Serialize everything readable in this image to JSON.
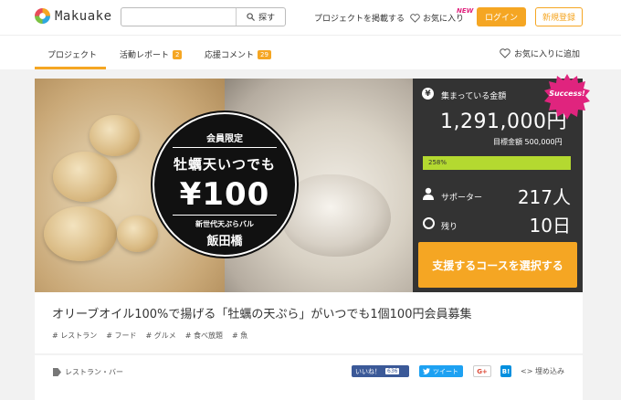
{
  "header": {
    "logo_text": "Makuake",
    "search_placeholder": "",
    "search_button": "探す",
    "post_project": "プロジェクトを掲載する",
    "favorites": "お気に入り",
    "new_badge": "NEW",
    "login": "ログイン",
    "signup": "新規登録"
  },
  "tabs": [
    {
      "label": "プロジェクト",
      "count": ""
    },
    {
      "label": "活動レポート",
      "count": "2"
    },
    {
      "label": "応援コメント",
      "count": "29"
    }
  ],
  "add_favorite": "お気に入りに追加",
  "hero": {
    "members_only": "会員限定",
    "headline": "牡蠣天いつでも",
    "price": "¥100",
    "subtitle": "新世代天ぷらバル",
    "place": "飯田橋"
  },
  "stats": {
    "raised_label": "集まっている金額",
    "raised_amount": "1,291,000円",
    "goal": "目標金額 500,000円",
    "progress_label": "258%",
    "progress_percent": 258,
    "supporters_label": "サポーター",
    "supporters_value": "217人",
    "remaining_label": "残り",
    "remaining_value": "10日",
    "success_badge": "Success!",
    "choose_button": "支援するコースを選択する"
  },
  "project": {
    "title": "オリーブオイル100%で揚げる「牡蠣の天ぷら」がいつでも1個100円会員募集",
    "tags": [
      "# レストラン",
      "# フード",
      "# グルメ",
      "# 食べ放題",
      "# 魚"
    ]
  },
  "footer": {
    "category": "レストラン・バー",
    "like_label": "いいね！",
    "like_count": "636",
    "tweet_label": "ツイート",
    "gplus_label": "G+",
    "hatena_label": "B!",
    "embed_label": "埋め込み"
  },
  "colors": {
    "accent": "#f5a623",
    "progress": "#b4d930",
    "panel": "#333333",
    "success": "#e0247e"
  }
}
